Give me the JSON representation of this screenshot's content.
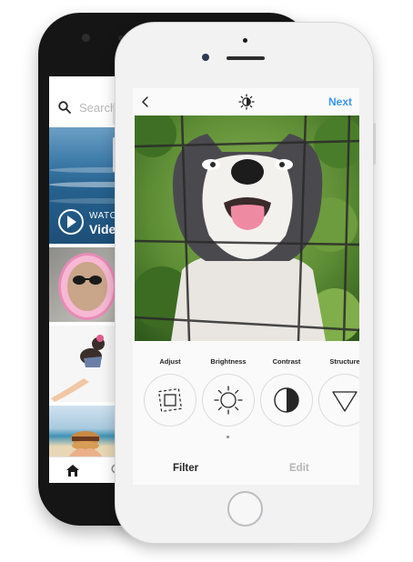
{
  "back_phone": {
    "search": {
      "placeholder": "Search",
      "icon": "search-icon"
    },
    "video_tile": {
      "watch_label": "WATCH",
      "title": "Videos",
      "icon": "play-icon"
    },
    "tabbar": {
      "home_icon": "home-icon",
      "search_icon": "search-icon"
    }
  },
  "editor": {
    "topbar": {
      "back_icon": "chevron-left-icon",
      "lux_icon": "lux-icon",
      "next_label": "Next"
    },
    "tools": [
      {
        "label": "Adjust",
        "icon": "adjust-icon"
      },
      {
        "label": "Brightness",
        "icon": "brightness-icon"
      },
      {
        "label": "Contrast",
        "icon": "contrast-icon"
      },
      {
        "label": "Structure",
        "icon": "structure-icon"
      }
    ],
    "tabs": {
      "filter": "Filter",
      "edit": "Edit"
    }
  },
  "colors": {
    "accent": "#3897f0",
    "text": "#262626",
    "muted": "#b5b5b5"
  }
}
